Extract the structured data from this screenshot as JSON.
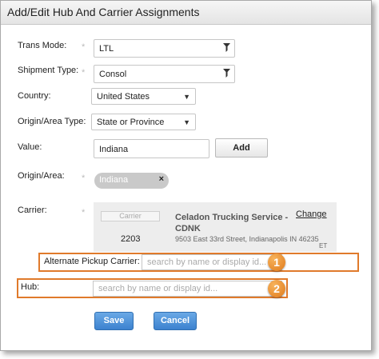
{
  "dialog": {
    "title": "Add/Edit Hub And Carrier Assignments"
  },
  "form": {
    "trans_mode": {
      "label": "Trans Mode:",
      "value": "LTL"
    },
    "shipment_type": {
      "label": "Shipment Type:",
      "value": "Consol"
    },
    "country": {
      "label": "Country:",
      "value": "United States"
    },
    "origin_area_type": {
      "label": "Origin/Area Type:",
      "value": "State or Province"
    },
    "value": {
      "label": "Value:",
      "input": "Indiana",
      "add_label": "Add"
    },
    "origin_area": {
      "label": "Origin/Area:",
      "tag": "Indiana",
      "remove_icon": "×"
    },
    "required_mark": "*",
    "carrier": {
      "label": "Carrier:",
      "placeholder": "Carrier",
      "number": "2203",
      "name": "Celadon Trucking Service - CDNK",
      "address": "9503 East 33rd Street, Indianapolis IN 46235",
      "tz": "ET",
      "change_label": "Change"
    },
    "alt_pickup": {
      "label": "Alternate Pickup Carrier:",
      "placeholder": "search by name or display id..."
    },
    "hub": {
      "label": "Hub:",
      "placeholder": "search by name or display id..."
    }
  },
  "callouts": {
    "one": "1",
    "two": "2",
    "color": "#e07a2b"
  },
  "actions": {
    "save": "Save",
    "cancel": "Cancel"
  }
}
